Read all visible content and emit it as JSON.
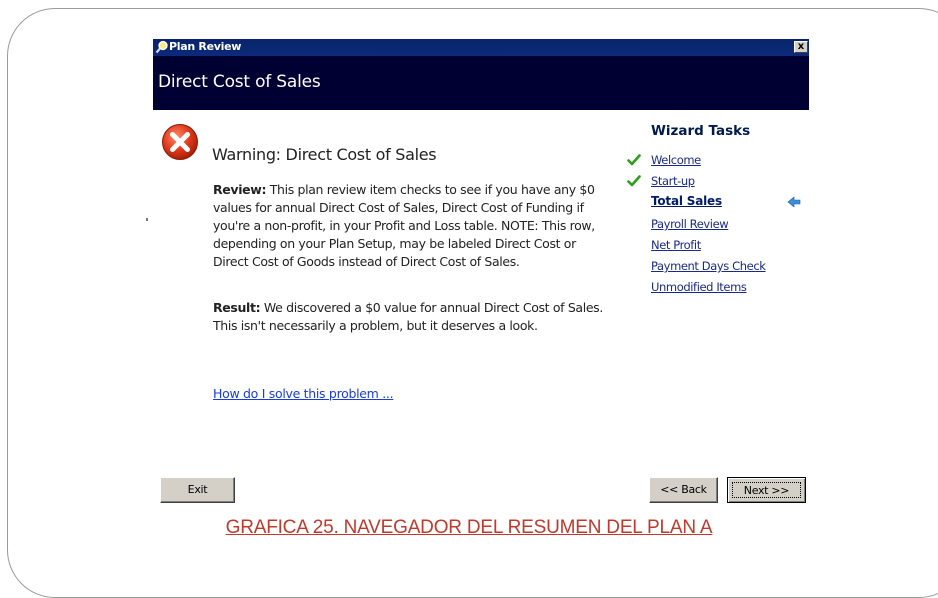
{
  "window": {
    "title": "Plan Review",
    "close_label": "x",
    "header_title": "Direct Cost of Sales"
  },
  "content": {
    "warning_title": "Warning: Direct Cost of Sales",
    "review_label": "Review:",
    "review_text": " This plan review item checks to see if you have any $0 values for annual Direct Cost of Sales, Direct Cost of Funding if you're a non-profit, in your Profit and Loss table. NOTE: This row, depending on your Plan Setup, may be labeled Direct Cost or Direct Cost of Goods instead of Direct Cost of Sales.",
    "result_label": "Result:",
    "result_text": " We discovered a $0 value for annual Direct Cost of Sales. This isn't necessarily a problem, but it deserves a look.",
    "help_link": "How do I solve this problem ..."
  },
  "wizard": {
    "title": "Wizard Tasks",
    "tasks": [
      {
        "label": "Welcome",
        "status": "done"
      },
      {
        "label": "Start-up",
        "status": "done"
      },
      {
        "label": "Total Sales",
        "status": "current"
      },
      {
        "label": "Payroll Review",
        "status": "pending"
      },
      {
        "label": "Net Profit",
        "status": "pending"
      },
      {
        "label": "Payment Days Check",
        "status": "pending"
      },
      {
        "label": "Unmodified Items",
        "status": "pending"
      }
    ]
  },
  "buttons": {
    "exit": "Exit",
    "back": "<< Back",
    "next": "Next >>"
  },
  "caption": "GRAFICA 25. NAVEGADOR DEL RESUMEN DEL PLAN A",
  "colors": {
    "titlebar": "#0a246a",
    "header": "#000033",
    "link": "#1a3cdc",
    "check": "#2e9e1a",
    "caption": "#c0392b"
  },
  "icons": {
    "title_icon": "magnifier-icon",
    "warning_icon": "error-x-icon",
    "done_icon": "checkmark-icon",
    "current_icon": "left-arrow-icon"
  }
}
